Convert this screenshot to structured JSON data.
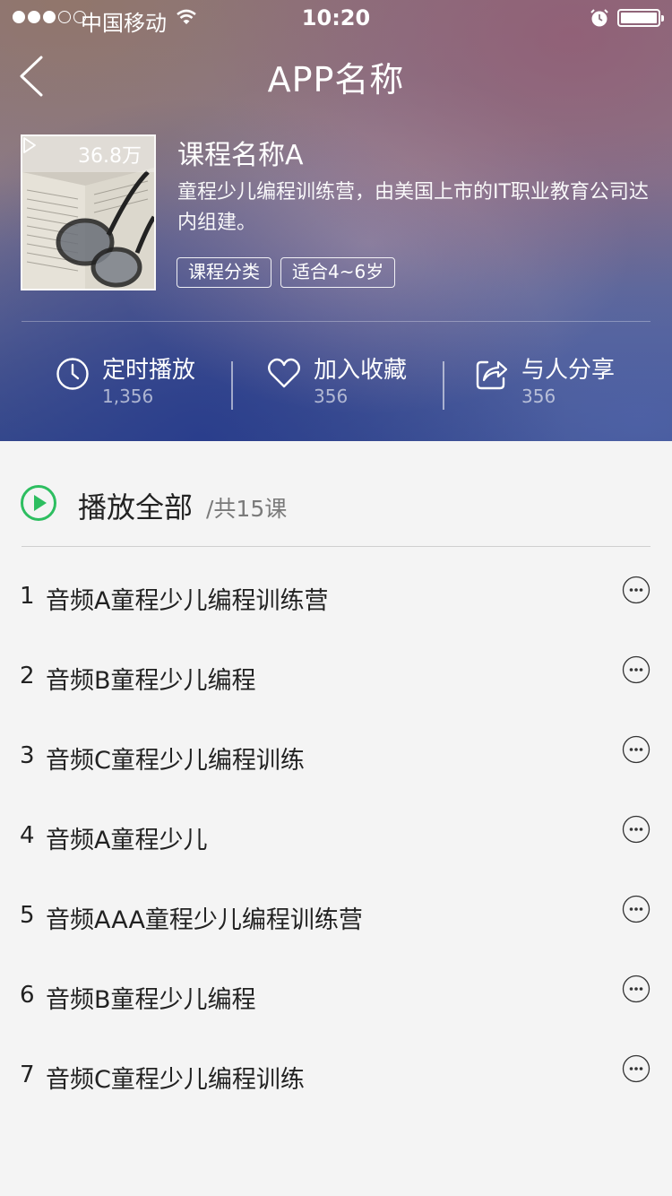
{
  "status_bar": {
    "carrier": "中国移动",
    "time": "10:20",
    "signal_strength": 3
  },
  "nav": {
    "title": "APP名称"
  },
  "course": {
    "play_count": "36.8万",
    "name": "课程名称A",
    "description": "童程少儿编程训练营，由美国上市的IT职业教育公司达内组建。",
    "tags": [
      "课程分类",
      "适合4~6岁"
    ]
  },
  "actions": [
    {
      "label": "定时播放",
      "count": "1,356",
      "icon": "clock-icon"
    },
    {
      "label": "加入收藏",
      "count": "356",
      "icon": "heart-icon"
    },
    {
      "label": "与人分享",
      "count": "356",
      "icon": "share-icon"
    }
  ],
  "playlist": {
    "play_all_label": "播放全部",
    "total_label": "/共15课",
    "tracks": [
      {
        "num": "1",
        "title": "音频A童程少儿编程训练营"
      },
      {
        "num": "2",
        "title": "音频B童程少儿编程"
      },
      {
        "num": "3",
        "title": "音频C童程少儿编程训练"
      },
      {
        "num": "4",
        "title": "音频A童程少儿"
      },
      {
        "num": "5",
        "title": "音频AAA童程少儿编程训练营"
      },
      {
        "num": "6",
        "title": "音频B童程少儿编程"
      },
      {
        "num": "7",
        "title": "音频C童程少儿编程训练"
      }
    ]
  },
  "colors": {
    "accent_green": "#2dbe60",
    "list_background": "#f4f4f4"
  }
}
